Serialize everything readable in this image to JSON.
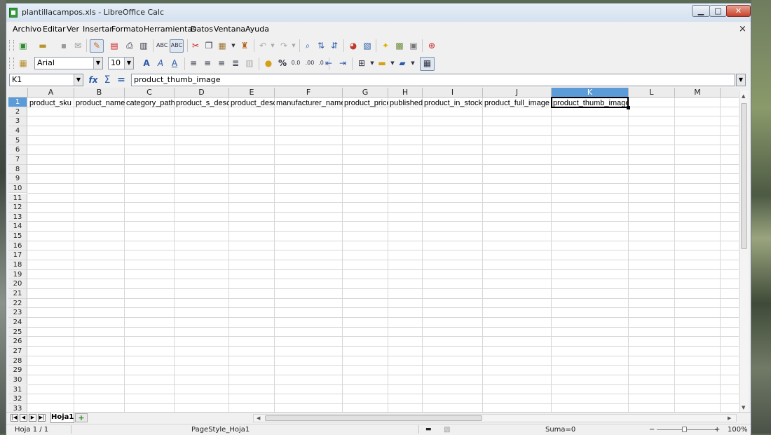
{
  "window": {
    "title": "plantillacampos.xls - LibreOffice Calc",
    "minimize": "▁",
    "maximize": "□",
    "close": "✕"
  },
  "menubar": {
    "items": [
      "Archivo",
      "Editar",
      "Ver",
      "Insertar",
      "Formato",
      "Herramientas",
      "Datos",
      "Ventana",
      "Ayuda"
    ],
    "close_doc": "×"
  },
  "format_toolbar": {
    "font_name": "Arial",
    "font_size": "10"
  },
  "formula_bar": {
    "name_box": "K1",
    "content": "product_thumb_image",
    "function_wizard_icon": "fx",
    "sum_icon": "Σ",
    "equals_icon": "="
  },
  "sheet": {
    "columns": [
      "A",
      "B",
      "C",
      "D",
      "E",
      "F",
      "G",
      "H",
      "I",
      "J",
      "K",
      "L",
      "M"
    ],
    "selected_column": "K",
    "selected_cell": "K1",
    "rows": [
      "1",
      "2",
      "3",
      "4",
      "5",
      "6",
      "7",
      "8",
      "9",
      "10",
      "11",
      "12",
      "13",
      "14",
      "15",
      "16",
      "17",
      "18",
      "19",
      "20",
      "21",
      "22",
      "23",
      "24",
      "25",
      "26",
      "27",
      "28",
      "29",
      "30",
      "31",
      "32",
      "33"
    ],
    "row1_cells": [
      "product_sku",
      "product_name",
      "category_path",
      "product_s_desc",
      "product_desc",
      "manufacturer_name",
      "product_price",
      "published",
      "product_in_stock",
      "product_full_image",
      "product_thumb_image"
    ]
  },
  "tabs": {
    "sheet_name": "Hoja1",
    "add_sheet": "+"
  },
  "statusbar": {
    "sheet_position": "Hoja 1 / 1",
    "page_style": "PageStyle_Hoja1",
    "sum": "Suma=0",
    "zoom": "100%",
    "zoom_minus": "−",
    "zoom_plus": "+"
  },
  "colors": {
    "selection_header": "#5a9bd8",
    "spellcheck_underline": "#d84b3f"
  }
}
